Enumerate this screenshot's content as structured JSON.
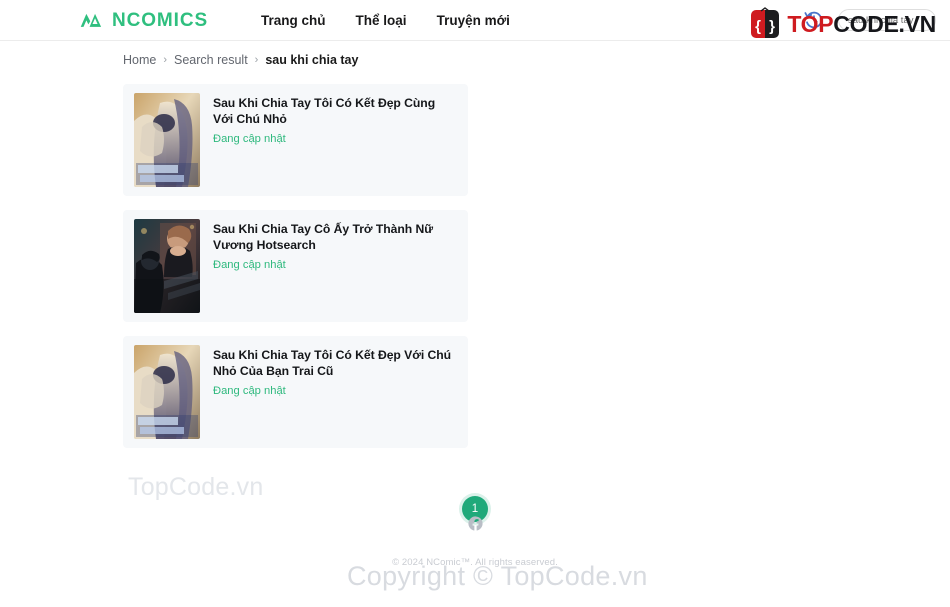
{
  "header": {
    "brand": {
      "name": "NCOMICS",
      "icon": "mountain-logo-icon",
      "color": "#2fbf7f"
    },
    "nav": [
      {
        "label": "Trang chủ"
      },
      {
        "label": "Thể loại"
      },
      {
        "label": "Truyện mới"
      }
    ],
    "history_icon": "history-clock-icon",
    "search": {
      "value": "sau khi chia tay",
      "placeholder": "sau khi chia tay"
    }
  },
  "watermark_badge": {
    "icon": "topcode-brace-icon",
    "text_primary": "TOP",
    "text_secondary": "CODE.VN",
    "color_primary": "#cf1b20",
    "color_secondary": "#16171b"
  },
  "breadcrumb": {
    "items": [
      {
        "label": "Home",
        "current": false
      },
      {
        "label": "Search result",
        "current": false
      },
      {
        "label": "sau khi chia tay",
        "current": true
      }
    ],
    "separator": "›"
  },
  "results": [
    {
      "title": "Sau Khi Chia Tay Tôi Có Kết Đẹp Cùng Với Chú Nhỏ",
      "status": "Đang cập nhật",
      "cover": "cover-couple-embrace-gold"
    },
    {
      "title": "Sau Khi Chia Tay Cô Ấy Trở Thành Nữ Vương Hotsearch",
      "status": "Đang cập nhật",
      "cover": "cover-woman-black-dress-dark"
    },
    {
      "title": "Sau Khi Chia Tay Tôi Có Kết Đẹp Với Chú Nhỏ Của Bạn Trai Cũ",
      "status": "Đang cập nhật",
      "cover": "cover-couple-embrace-gold"
    }
  ],
  "pagination": {
    "pages": [
      {
        "label": "1",
        "active": true
      }
    ]
  },
  "footer": {
    "facebook_icon": "facebook-icon",
    "copyright": "© 2024 NComic™. All rights easerved."
  },
  "watermarks": {
    "small": "TopCode.vn",
    "large": "Copyright © TopCode.vn"
  },
  "colors": {
    "brand_green": "#2fbf7f",
    "status_green": "#2fb97e",
    "page_active": "#1fa97a",
    "card_bg": "#f6f8fa"
  }
}
